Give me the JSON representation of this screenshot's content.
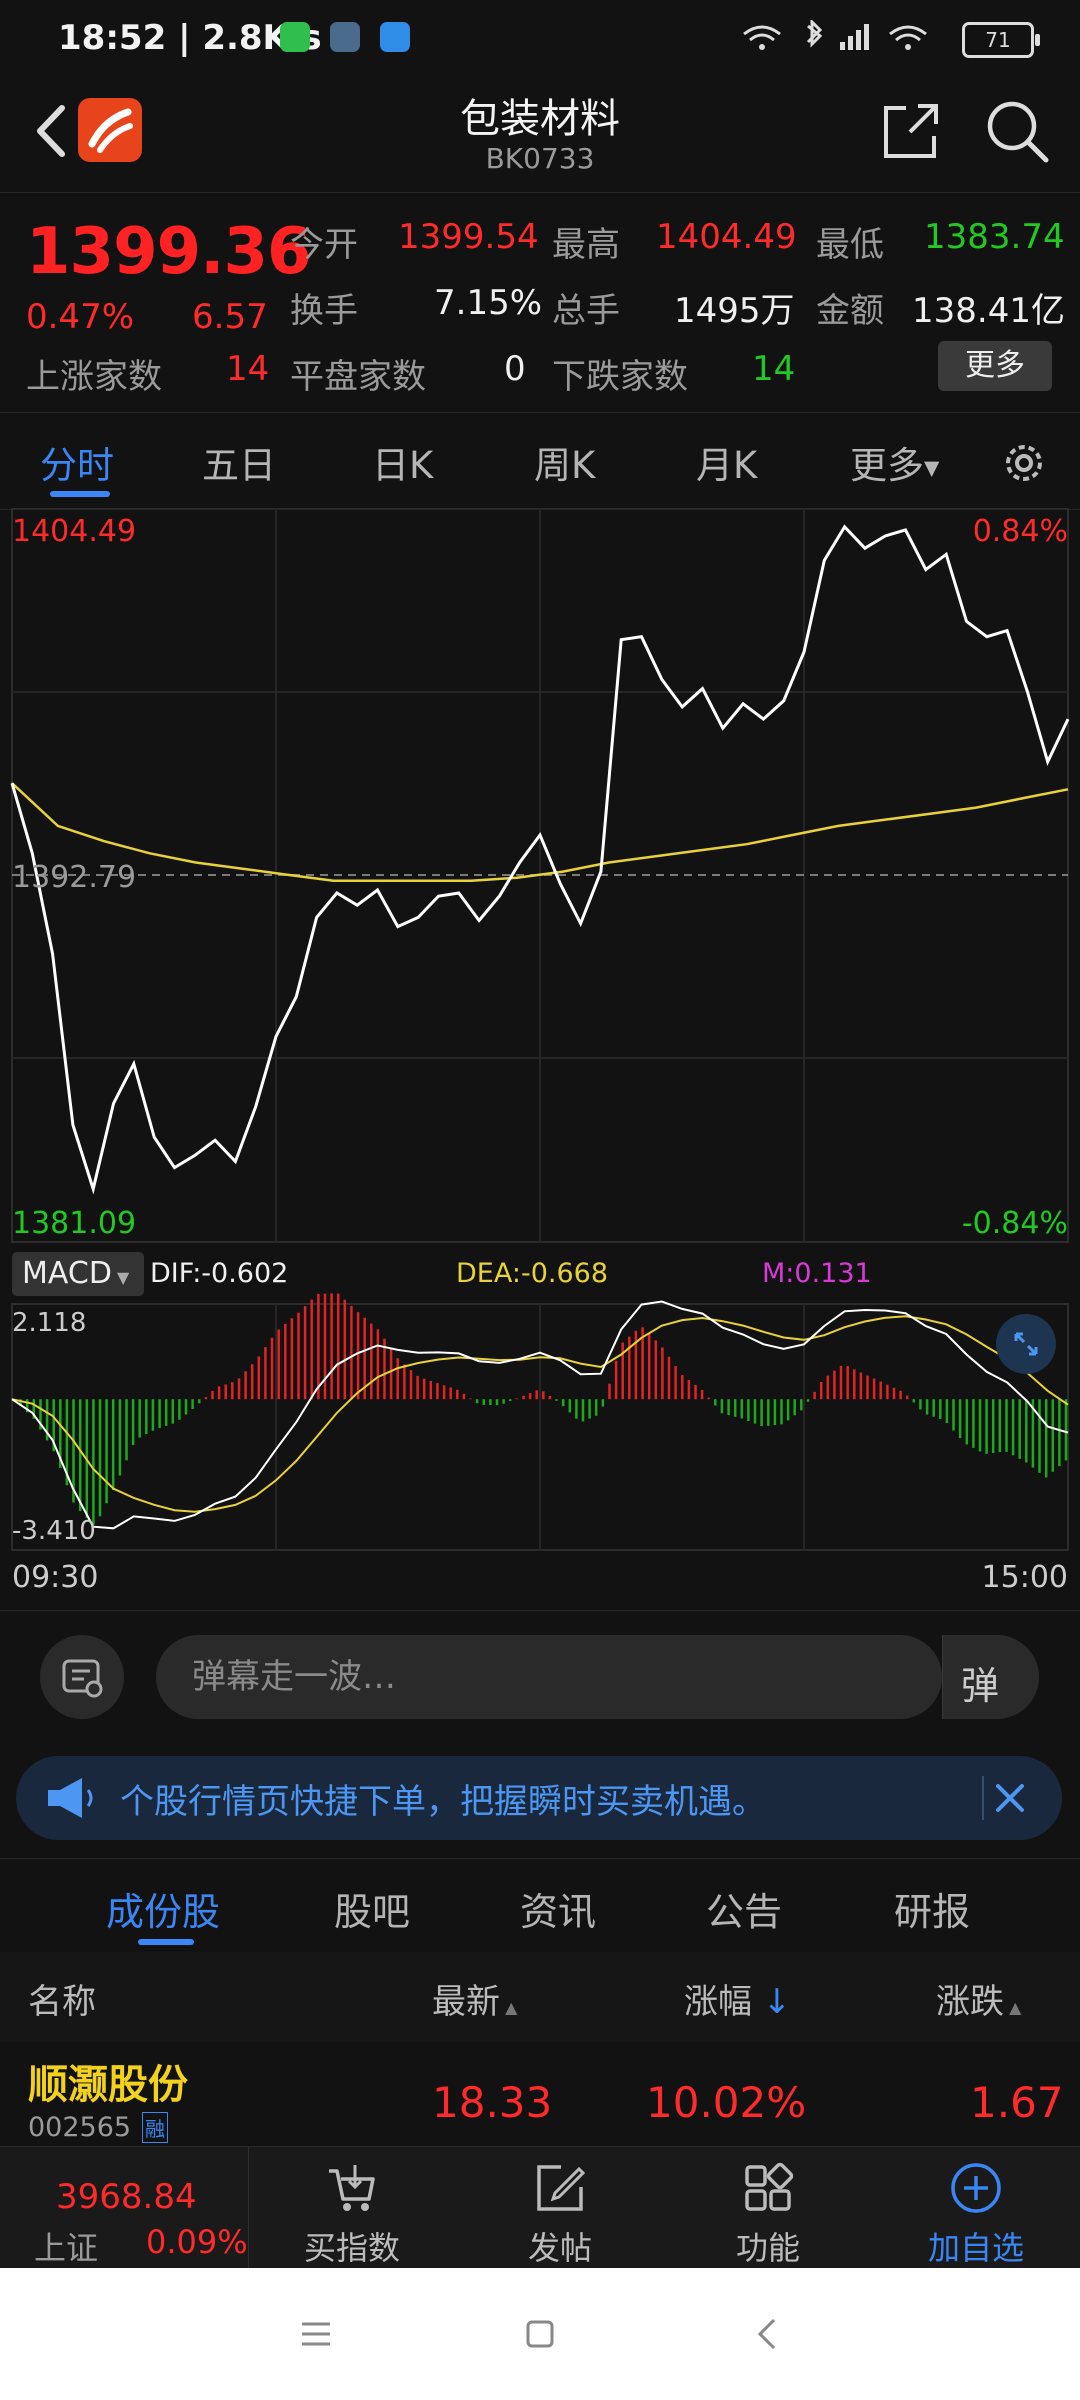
{
  "status": {
    "time": "18:52",
    "speed": "2.8K/s",
    "battery": "71"
  },
  "header": {
    "title": "包装材料",
    "code": "BK0733"
  },
  "quote": {
    "price": "1399.36",
    "change_pct": "0.47%",
    "change": "6.57",
    "open_label": "今开",
    "open": "1399.54",
    "high_label": "最高",
    "high": "1404.49",
    "low_label": "最低",
    "low": "1383.74",
    "turnover_label": "换手",
    "turnover": "7.15%",
    "volume_label": "总手",
    "volume": "1495万",
    "amount_label": "金额",
    "amount": "138.41亿",
    "up_label": "上涨家数",
    "up": "14",
    "flat_label": "平盘家数",
    "flat": "0",
    "down_label": "下跌家数",
    "down": "14",
    "more_label": "更多"
  },
  "period_tabs": [
    "分时",
    "五日",
    "日K",
    "周K",
    "月K",
    "更多"
  ],
  "chart_data": {
    "type": "line",
    "price_axis": {
      "top": "1404.49",
      "mid": "1392.79",
      "bottom": "1381.09",
      "top_pct": "0.84%",
      "bottom_pct": "-0.84%",
      "ylim": [
        1381.09,
        1404.49
      ]
    },
    "time_axis": {
      "start": "09:30",
      "end": "15:00"
    },
    "series": [
      {
        "color": "#ffffff",
        "values": [
          1395.8,
          1393.5,
          1390.2,
          1384.6,
          1382.5,
          1385.3,
          1386.6,
          1384.2,
          1383.2,
          1383.6,
          1384.1,
          1383.4,
          1385.2,
          1387.5,
          1388.8,
          1391.4,
          1392.2,
          1391.8,
          1392.3,
          1391.1,
          1391.4,
          1392.1,
          1392.2,
          1391.3,
          1392.1,
          1393.2,
          1394.1,
          1392.5,
          1391.2,
          1392.9,
          1400.5,
          1400.6,
          1399.2,
          1398.3,
          1398.9,
          1397.6,
          1398.4,
          1397.9,
          1398.5,
          1400.1,
          1403.1,
          1404.2,
          1403.5,
          1403.9,
          1404.1,
          1402.8,
          1403.3,
          1401.1,
          1400.6,
          1400.8,
          1398.8,
          1396.5,
          1397.9
        ]
      },
      {
        "color": "#e8d23a",
        "values": [
          1395.8,
          1394.4,
          1393.9,
          1393.5,
          1393.2,
          1393.0,
          1392.8,
          1392.6,
          1392.6,
          1392.6,
          1392.6,
          1392.7,
          1392.9,
          1393.2,
          1393.4,
          1393.6,
          1393.8,
          1394.1,
          1394.4,
          1394.6,
          1394.8,
          1395.0,
          1395.3,
          1395.6
        ]
      }
    ]
  },
  "macd": {
    "button": "MACD",
    "dif_label": "DIF:",
    "dif": "-0.602",
    "dea_label": "DEA:",
    "dea": "-0.668",
    "m_label": "M:",
    "m": "0.131",
    "top": "2.118",
    "bottom": "-3.410",
    "ylim": [
      -3.41,
      2.118
    ]
  },
  "danmaku": {
    "placeholder": "弹幕走一波…",
    "toggle": "弹"
  },
  "banner": {
    "text": "个股行情页快捷下单，把握瞬时买卖机遇。"
  },
  "sub_tabs": [
    "成份股",
    "股吧",
    "资讯",
    "公告",
    "研报"
  ],
  "table": {
    "headers": {
      "name": "名称",
      "latest": "最新",
      "pct": "涨幅",
      "change": "涨跌"
    },
    "rows": [
      {
        "name": "顺灏股份",
        "code": "002565",
        "badge": "融",
        "latest": "18.33",
        "pct": "10.02%",
        "change": "1.67"
      }
    ]
  },
  "toolbar": {
    "index_value": "3968.84",
    "index_name": "上证",
    "index_pct": "0.09%",
    "buy_index": "买指数",
    "post": "发帖",
    "functions": "功能",
    "add_watch": "加自选"
  },
  "colors": {
    "up": "#ff2a2a",
    "down": "#22c922",
    "accent": "#3b86f5",
    "avg_line": "#e8d23a",
    "dea_line": "#e8d23a",
    "m_label": "#d83ad8"
  }
}
